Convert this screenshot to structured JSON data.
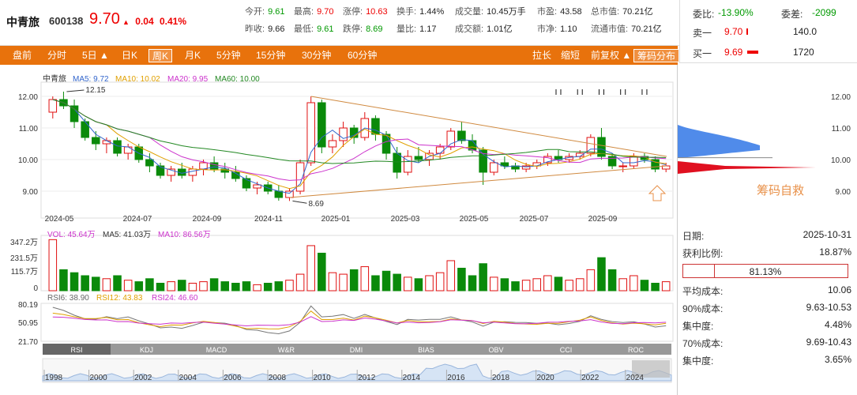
{
  "header": {
    "name": "中青旅",
    "code": "600138",
    "price": "9.70",
    "arrow": "▲",
    "change": "0.04",
    "change_pct": "0.41%",
    "quotes_col1": [
      {
        "label": "今开:",
        "value": "9.61",
        "color": "green"
      },
      {
        "label": "昨收:",
        "value": "9.66",
        "color": "black"
      }
    ],
    "quotes_col2": [
      {
        "label": "最高:",
        "value": "9.70",
        "color": "red"
      },
      {
        "label": "最低:",
        "value": "9.61",
        "color": "green"
      }
    ],
    "quotes_col3": [
      {
        "label": "涨停:",
        "value": "10.63",
        "color": "red"
      },
      {
        "label": "跌停:",
        "value": "8.69",
        "color": "green"
      }
    ],
    "quotes_col4": [
      {
        "label": "换手:",
        "value": "1.44%",
        "color": "black"
      },
      {
        "label": "量比:",
        "value": "1.17",
        "color": "black"
      }
    ],
    "quotes_col5": [
      {
        "label": "成交量:",
        "value": "10.45万手",
        "color": "black"
      },
      {
        "label": "成交额:",
        "value": "1.01亿",
        "color": "black"
      }
    ],
    "quotes_col6": [
      {
        "label": "市盈:",
        "value": "43.58",
        "color": "black"
      },
      {
        "label": "市净:",
        "value": "1.10",
        "color": "black"
      }
    ],
    "quotes_col7": [
      {
        "label": "总市值:",
        "value": "70.21亿",
        "color": "black"
      },
      {
        "label": "流通市值:",
        "value": "70.21亿",
        "color": "black"
      }
    ]
  },
  "orderbook": {
    "weibi_label": "委比:",
    "weibi_value": "-13.90%",
    "weicha_label": "委差:",
    "weicha_value": "-2099",
    "sell1_label": "卖一",
    "sell1_price": "9.70",
    "sell1_vol": "140.0",
    "buy1_label": "买一",
    "buy1_price": "9.69",
    "buy1_vol": "1720"
  },
  "toolbar": {
    "items": [
      "盘前",
      "分时",
      "5日 ▲",
      "日K",
      "周K",
      "月K",
      "5分钟",
      "15分钟",
      "30分钟",
      "60分钟"
    ],
    "active_index": 4,
    "right_items": [
      "拉长",
      "缩短",
      "前复权 ▲",
      "筹码分布"
    ]
  },
  "ma_legend": {
    "name": "中青旅",
    "ma5": "MA5: 9.72",
    "ma10": "MA10: 10.02",
    "ma20": "MA20: 9.95",
    "ma60": "MA60: 10.00",
    "colors": {
      "ma5": "#3366cc",
      "ma10": "#e0a000",
      "ma20": "#cc33cc",
      "ma60": "#228822"
    }
  },
  "price_axis": [
    "12.00",
    "11.00",
    "10.00",
    "9.00"
  ],
  "right_price_axis": [
    "12.00",
    "11.00",
    "10.00",
    "9.00"
  ],
  "date_axis": [
    "2024-05",
    "2024-07",
    "2024-09",
    "2024-11",
    "2025-01",
    "2025-03",
    "2025-05",
    "2025-07",
    "2025-09"
  ],
  "annotations": {
    "high": "12.15",
    "low": "8.69",
    "chip_label": "筹码自救"
  },
  "vol_legend": {
    "vol": "VOL: 45.64万",
    "ma5": "MA5: 41.03万",
    "ma10": "MA10: 86.56万"
  },
  "vol_axis": [
    "347.2万",
    "231.5万",
    "115.7万",
    "0"
  ],
  "rsi_legend": {
    "rsi6": "RSI6: 38.90",
    "rsi12": "RSI12: 43.83",
    "rsi24": "RSI24: 46.60"
  },
  "rsi_axis": [
    "80.19",
    "50.95",
    "21.70"
  ],
  "indicator_tabs": [
    "RSI",
    "KDJ",
    "MACD",
    "W&R",
    "DMI",
    "BIAS",
    "OBV",
    "CCI",
    "ROC"
  ],
  "year_axis": [
    "1998",
    "2000",
    "2002",
    "2004",
    "2006",
    "2008",
    "2010",
    "2012",
    "2014",
    "2016",
    "2018",
    "2020",
    "2022",
    "2024"
  ],
  "chip_panel": {
    "rows": [
      {
        "label": "日期:",
        "value": "2025-10-31"
      },
      {
        "label": "获利比例:",
        "value": "18.87%"
      }
    ],
    "profit_bar_pct": "81.13%",
    "profit_fraction": 0.19,
    "rows2": [
      {
        "label": "平均成本:",
        "value": "10.06"
      },
      {
        "label": "90%成本:",
        "value": "9.63-10.53"
      },
      {
        "label": "集中度:",
        "value": "4.48%"
      },
      {
        "label": "70%成本:",
        "value": "9.69-10.43"
      },
      {
        "label": "集中度:",
        "value": "3.65%"
      }
    ]
  },
  "chart_data": {
    "type": "candlestick",
    "ylim": [
      8.5,
      12.3
    ],
    "candles": [
      [
        11.5,
        12.0,
        11.3,
        11.9
      ],
      [
        11.9,
        12.15,
        11.6,
        11.7
      ],
      [
        11.7,
        11.9,
        11.0,
        11.2
      ],
      [
        11.2,
        11.3,
        10.6,
        10.7
      ],
      [
        10.7,
        10.9,
        10.3,
        10.5
      ],
      [
        10.5,
        10.7,
        10.2,
        10.6
      ],
      [
        10.6,
        10.7,
        10.1,
        10.2
      ],
      [
        10.2,
        10.5,
        10.0,
        10.4
      ],
      [
        10.4,
        10.5,
        9.9,
        10.0
      ],
      [
        10.0,
        10.2,
        9.6,
        9.8
      ],
      [
        9.8,
        9.9,
        9.4,
        9.5
      ],
      [
        9.5,
        9.8,
        9.3,
        9.7
      ],
      [
        9.7,
        9.9,
        9.4,
        9.5
      ],
      [
        9.5,
        9.8,
        9.3,
        9.7
      ],
      [
        9.7,
        10.0,
        9.5,
        9.9
      ],
      [
        9.9,
        10.1,
        9.6,
        9.7
      ],
      [
        9.7,
        9.9,
        9.4,
        9.6
      ],
      [
        9.6,
        9.8,
        9.3,
        9.4
      ],
      [
        9.4,
        9.5,
        9.0,
        9.1
      ],
      [
        9.1,
        9.3,
        8.9,
        9.2
      ],
      [
        9.2,
        9.3,
        8.9,
        9.0
      ],
      [
        9.0,
        9.2,
        8.7,
        8.8
      ],
      [
        8.8,
        9.1,
        8.69,
        9.0
      ],
      [
        9.0,
        10.0,
        8.9,
        9.9
      ],
      [
        9.9,
        12.0,
        9.8,
        11.8
      ],
      [
        11.8,
        11.9,
        10.2,
        10.4
      ],
      [
        10.4,
        10.8,
        10.2,
        10.6
      ],
      [
        10.6,
        11.2,
        10.4,
        11.0
      ],
      [
        11.0,
        11.1,
        10.5,
        10.7
      ],
      [
        10.7,
        11.5,
        10.6,
        11.3
      ],
      [
        11.3,
        11.4,
        10.6,
        10.8
      ],
      [
        10.8,
        10.9,
        10.0,
        10.2
      ],
      [
        10.2,
        10.4,
        9.4,
        9.6
      ],
      [
        9.6,
        10.3,
        9.5,
        10.1
      ],
      [
        10.1,
        10.4,
        9.9,
        10.0
      ],
      [
        10.0,
        10.3,
        9.8,
        10.2
      ],
      [
        10.2,
        10.5,
        10.0,
        10.4
      ],
      [
        10.4,
        11.0,
        10.3,
        10.9
      ],
      [
        10.9,
        11.2,
        10.5,
        10.6
      ],
      [
        10.6,
        10.8,
        10.2,
        10.3
      ],
      [
        10.3,
        10.4,
        9.2,
        9.6
      ],
      [
        9.6,
        10.0,
        9.5,
        9.9
      ],
      [
        9.9,
        10.1,
        9.7,
        9.8
      ],
      [
        9.8,
        9.9,
        9.6,
        9.7
      ],
      [
        9.7,
        9.9,
        9.6,
        9.8
      ],
      [
        9.8,
        10.0,
        9.7,
        9.9
      ],
      [
        9.9,
        10.2,
        9.8,
        10.1
      ],
      [
        10.1,
        10.3,
        9.9,
        10.0
      ],
      [
        10.0,
        10.2,
        9.9,
        10.1
      ],
      [
        10.1,
        10.3,
        10.0,
        10.2
      ],
      [
        10.2,
        10.8,
        10.1,
        10.7
      ],
      [
        10.7,
        11.0,
        10.0,
        10.1
      ],
      [
        10.1,
        10.2,
        9.7,
        9.8
      ],
      [
        9.8,
        9.9,
        9.6,
        9.8
      ],
      [
        9.8,
        10.2,
        9.7,
        10.1
      ],
      [
        10.1,
        10.2,
        9.9,
        10.0
      ],
      [
        10.0,
        10.1,
        9.6,
        9.7
      ],
      [
        9.7,
        9.9,
        9.6,
        9.8
      ]
    ]
  }
}
